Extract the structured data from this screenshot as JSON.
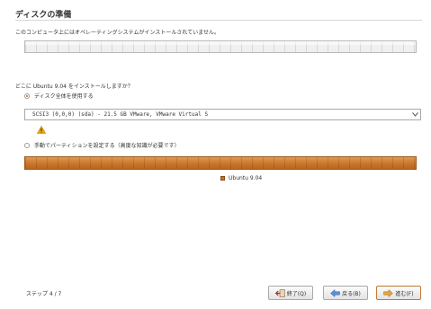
{
  "header": {
    "title": "ディスクの準備",
    "subtitle": "このコンピュータ上にはオペレーティングシステムがインストールされていません。"
  },
  "install": {
    "question": "どこに Ubuntu 9.04 をインストールしますか？",
    "option_whole_disk": "ディスク全体を使用する",
    "option_whole_disk_selected": true,
    "disk_selected": "SCSI3 (0,0,0) (sda) - 21.5 GB VMware, VMware Virtual S",
    "option_manual": "手動でパーティションを設定する（高度な知識が必要です）",
    "option_manual_selected": false
  },
  "partition_preview": {
    "legend_label": "Ubuntu 9.04",
    "legend_color": "#c8732a"
  },
  "footer": {
    "step": "ステップ 4 / 7",
    "quit_label": "終了(Q)",
    "back_label": "戻る(B)",
    "forward_label": "進む(F)"
  },
  "icons": {
    "warning": "warning-triangle-icon",
    "quit": "quit-icon",
    "back": "arrow-left-icon",
    "forward": "arrow-right-icon"
  },
  "colors": {
    "accent": "#c8732a",
    "warning": "#f2a900"
  }
}
